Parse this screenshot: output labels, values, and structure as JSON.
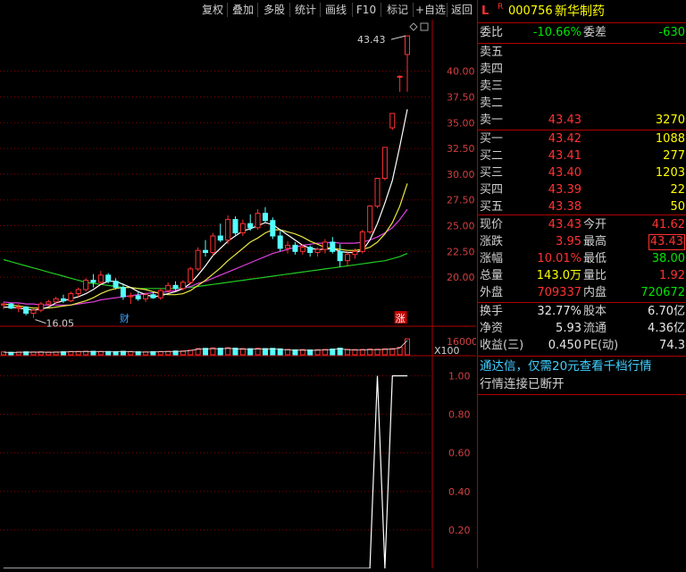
{
  "toolbar": {
    "items": [
      "复权",
      "叠加",
      "多股",
      "统计",
      "画线",
      "F10",
      "标记",
      "+自选",
      "返回"
    ]
  },
  "header": {
    "flag_l": "L",
    "flag_r": "R",
    "code": "000756",
    "name": "新华制药"
  },
  "weibi": {
    "label": "委比",
    "value": "-10.66%",
    "diff_label": "委差",
    "diff_value": "-630"
  },
  "sell": [
    {
      "label": "卖五",
      "price": "",
      "vol": ""
    },
    {
      "label": "卖四",
      "price": "",
      "vol": ""
    },
    {
      "label": "卖三",
      "price": "",
      "vol": ""
    },
    {
      "label": "卖二",
      "price": "",
      "vol": ""
    },
    {
      "label": "卖一",
      "price": "43.43",
      "vol": "3270"
    }
  ],
  "buy": [
    {
      "label": "买一",
      "price": "43.42",
      "vol": "1088"
    },
    {
      "label": "买二",
      "price": "43.41",
      "vol": "277"
    },
    {
      "label": "买三",
      "price": "43.40",
      "vol": "1203"
    },
    {
      "label": "买四",
      "price": "43.39",
      "vol": "22"
    },
    {
      "label": "买五",
      "price": "43.38",
      "vol": "50"
    }
  ],
  "quote": [
    {
      "l1": "现价",
      "v1": "43.43",
      "c1": "red",
      "l2": "今开",
      "v2": "41.62",
      "c2": "red"
    },
    {
      "l1": "涨跌",
      "v1": "3.95",
      "c1": "red",
      "l2": "最高",
      "v2": "43.43",
      "c2": "red"
    },
    {
      "l1": "涨幅",
      "v1": "10.01%",
      "c1": "red",
      "l2": "最低",
      "v2": "38.00",
      "c2": "green"
    },
    {
      "l1": "总量",
      "v1": "143.0万",
      "c1": "yellow",
      "l2": "量比",
      "v2": "1.92",
      "c2": "red"
    },
    {
      "l1": "外盘",
      "v1": "709337",
      "c1": "red",
      "l2": "内盘",
      "v2": "720672",
      "c2": "green"
    }
  ],
  "fund": [
    {
      "l1": "换手",
      "v1": "32.77%",
      "l2": "股本",
      "v2": "6.70亿"
    },
    {
      "l1": "净资",
      "v1": "5.93",
      "l2": "流通",
      "v2": "4.36亿"
    },
    {
      "l1": "收益(三)",
      "v1": "0.450",
      "l2": "PE(动)",
      "v2": "74.3"
    }
  ],
  "notice": {
    "promo": "通达信，仅需20元查看千档行情",
    "status": "行情连接已断开"
  },
  "chart_labels": {
    "high_marker": "43.43",
    "low_marker": "16.05",
    "event_cai": "财",
    "event_zhang": "涨",
    "vol_axis": "16000",
    "vol_unit": "X100"
  },
  "chart_data": [
    {
      "type": "candlestick",
      "ylim": [
        15.5,
        45
      ],
      "yticks": [
        20.0,
        22.5,
        25.0,
        27.5,
        30.0,
        32.5,
        35.0,
        37.5,
        40.0
      ],
      "candles": [
        [
          17.3,
          17.6,
          16.9,
          17.4
        ],
        [
          17.4,
          17.5,
          16.9,
          17.0
        ],
        [
          17.0,
          17.4,
          16.6,
          17.1
        ],
        [
          17.1,
          17.2,
          16.3,
          16.5
        ],
        [
          16.5,
          17.0,
          16.05,
          16.8
        ],
        [
          16.8,
          17.6,
          16.6,
          17.4
        ],
        [
          17.4,
          17.8,
          17.2,
          17.6
        ],
        [
          17.6,
          18.1,
          17.4,
          17.9
        ],
        [
          17.9,
          18.3,
          17.5,
          17.7
        ],
        [
          17.7,
          18.6,
          17.6,
          18.4
        ],
        [
          18.4,
          19.0,
          18.1,
          18.8
        ],
        [
          18.8,
          19.9,
          18.6,
          19.7
        ],
        [
          19.7,
          20.3,
          19.0,
          19.5
        ],
        [
          19.5,
          20.6,
          19.3,
          20.2
        ],
        [
          20.2,
          20.4,
          19.4,
          19.6
        ],
        [
          19.6,
          19.9,
          18.8,
          19.0
        ],
        [
          19.0,
          19.4,
          17.8,
          18.1
        ],
        [
          18.1,
          18.5,
          17.4,
          18.2
        ],
        [
          18.2,
          18.6,
          17.7,
          17.9
        ],
        [
          17.9,
          18.5,
          17.6,
          18.3
        ],
        [
          18.3,
          18.6,
          17.9,
          18.0
        ],
        [
          18.0,
          18.9,
          17.8,
          18.7
        ],
        [
          18.7,
          19.5,
          18.5,
          19.2
        ],
        [
          19.2,
          19.6,
          18.7,
          18.9
        ],
        [
          18.9,
          19.7,
          18.7,
          19.5
        ],
        [
          19.5,
          21.0,
          19.3,
          20.8
        ],
        [
          20.8,
          22.9,
          20.6,
          22.6
        ],
        [
          22.6,
          23.6,
          22.0,
          22.4
        ],
        [
          22.4,
          24.3,
          22.1,
          24.0
        ],
        [
          24.0,
          25.2,
          23.4,
          23.6
        ],
        [
          23.6,
          26.0,
          23.2,
          25.6
        ],
        [
          25.6,
          25.9,
          24.1,
          24.3
        ],
        [
          24.3,
          25.6,
          24.0,
          25.2
        ],
        [
          25.2,
          26.1,
          24.5,
          24.8
        ],
        [
          24.8,
          26.6,
          24.6,
          26.2
        ],
        [
          26.2,
          26.8,
          25.3,
          25.5
        ],
        [
          25.5,
          25.8,
          23.7,
          24.0
        ],
        [
          24.0,
          24.5,
          22.5,
          22.8
        ],
        [
          22.8,
          23.5,
          22.3,
          23.1
        ],
        [
          23.1,
          23.4,
          22.2,
          22.5
        ],
        [
          22.5,
          23.2,
          22.2,
          22.9
        ],
        [
          22.9,
          23.1,
          22.0,
          22.4
        ],
        [
          22.4,
          22.9,
          22.0,
          22.7
        ],
        [
          22.7,
          23.7,
          22.3,
          23.4
        ],
        [
          23.4,
          23.9,
          22.3,
          22.5
        ],
        [
          22.5,
          23.2,
          21.0,
          21.6
        ],
        [
          21.6,
          22.4,
          21.1,
          22.2
        ],
        [
          22.2,
          22.8,
          21.8,
          22.5
        ],
        [
          22.5,
          24.6,
          22.3,
          24.4
        ],
        [
          24.4,
          27.0,
          24.2,
          26.9
        ],
        [
          26.9,
          29.6,
          26.7,
          29.6
        ],
        [
          29.6,
          32.6,
          29.4,
          32.6
        ],
        [
          34.5,
          35.9,
          34.3,
          35.9
        ],
        [
          39.5,
          39.6,
          38.0,
          39.5
        ],
        [
          41.62,
          43.43,
          38.0,
          43.43
        ]
      ],
      "ma5": [
        17.1,
        17.1,
        17.0,
        16.9,
        16.8,
        16.9,
        17.1,
        17.5,
        17.7,
        17.9,
        18.1,
        18.4,
        18.8,
        19.3,
        19.6,
        19.6,
        19.3,
        19.0,
        18.6,
        18.3,
        18.1,
        18.2,
        18.4,
        18.6,
        18.9,
        19.4,
        20.2,
        21.1,
        22.1,
        22.8,
        23.5,
        24.0,
        24.5,
        24.7,
        25.0,
        25.3,
        25.1,
        24.6,
        24.1,
        23.6,
        23.1,
        22.8,
        22.7,
        22.7,
        22.8,
        22.5,
        22.4,
        22.4,
        22.6,
        23.6,
        25.2,
        27.2,
        29.4,
        32.7,
        36.3
      ],
      "ma10": [
        17.4,
        17.3,
        17.2,
        17.1,
        17.0,
        17.0,
        17.0,
        17.1,
        17.2,
        17.3,
        17.5,
        17.7,
        18.0,
        18.4,
        18.7,
        18.9,
        19.0,
        19.0,
        18.9,
        18.8,
        18.6,
        18.4,
        18.3,
        18.3,
        18.4,
        18.7,
        19.2,
        19.7,
        20.3,
        20.9,
        21.6,
        22.2,
        22.8,
        23.4,
        23.8,
        24.3,
        24.6,
        24.6,
        24.4,
        24.2,
        23.9,
        23.5,
        23.2,
        22.9,
        22.8,
        22.7,
        22.6,
        22.6,
        22.7,
        22.9,
        23.4,
        24.2,
        25.3,
        26.9,
        29.1
      ],
      "ma20": [
        17.6,
        17.5,
        17.5,
        17.4,
        17.4,
        17.3,
        17.3,
        17.3,
        17.3,
        17.3,
        17.4,
        17.5,
        17.6,
        17.8,
        17.9,
        18.0,
        18.1,
        18.2,
        18.3,
        18.4,
        18.5,
        18.5,
        18.6,
        18.7,
        18.9,
        19.1,
        19.4,
        19.6,
        19.9,
        20.2,
        20.5,
        20.8,
        21.1,
        21.4,
        21.7,
        22.0,
        22.3,
        22.5,
        22.7,
        22.9,
        23.1,
        23.2,
        23.3,
        23.3,
        23.4,
        23.3,
        23.3,
        23.3,
        23.4,
        23.6,
        23.9,
        24.3,
        24.8,
        25.6,
        26.6
      ],
      "ma60": [
        21.7,
        21.5,
        21.3,
        21.1,
        20.9,
        20.7,
        20.5,
        20.3,
        20.1,
        19.9,
        19.7,
        19.5,
        19.4,
        19.3,
        19.2,
        19.1,
        19.0,
        19.0,
        18.9,
        18.9,
        18.9,
        18.9,
        18.9,
        18.9,
        19.0,
        19.0,
        19.1,
        19.2,
        19.3,
        19.4,
        19.5,
        19.6,
        19.7,
        19.8,
        19.9,
        20.0,
        20.1,
        20.2,
        20.3,
        20.4,
        20.5,
        20.6,
        20.7,
        20.8,
        20.9,
        21.0,
        21.1,
        21.2,
        21.3,
        21.4,
        21.5,
        21.6,
        21.8,
        22.0,
        22.3
      ]
    },
    {
      "type": "bar",
      "title": "volume",
      "ylim": [
        0,
        16000
      ],
      "values": [
        2600,
        2300,
        2500,
        2700,
        2600,
        2700,
        2500,
        2600,
        2800,
        3000,
        3100,
        3300,
        3200,
        3100,
        3000,
        2900,
        3200,
        3000,
        2800,
        2700,
        2900,
        3000,
        3200,
        3400,
        3500,
        4200,
        5600,
        5800,
        6200,
        5900,
        6400,
        6000,
        5600,
        5500,
        5900,
        5600,
        5800,
        5400,
        4900,
        4500,
        4700,
        4400,
        4600,
        4800,
        5200,
        6000,
        5000,
        4700,
        4800,
        5200,
        5100,
        5400,
        5600,
        6800,
        14300
      ]
    },
    {
      "type": "line",
      "ylim": [
        0,
        1.1
      ],
      "yticks": [
        0.2,
        0.4,
        0.6,
        0.8,
        1.0
      ],
      "values": [
        0,
        0,
        0,
        0,
        0,
        0,
        0,
        0,
        0,
        0,
        0,
        0,
        0,
        0,
        0,
        0,
        0,
        0,
        0,
        0,
        0,
        0,
        0,
        0,
        0,
        0,
        0,
        0,
        0,
        0,
        0,
        0,
        0,
        0,
        0,
        0,
        0,
        0,
        0,
        0,
        0,
        0,
        0,
        0,
        0,
        0,
        0,
        0,
        0,
        0,
        1,
        0,
        1,
        1,
        1
      ]
    }
  ]
}
